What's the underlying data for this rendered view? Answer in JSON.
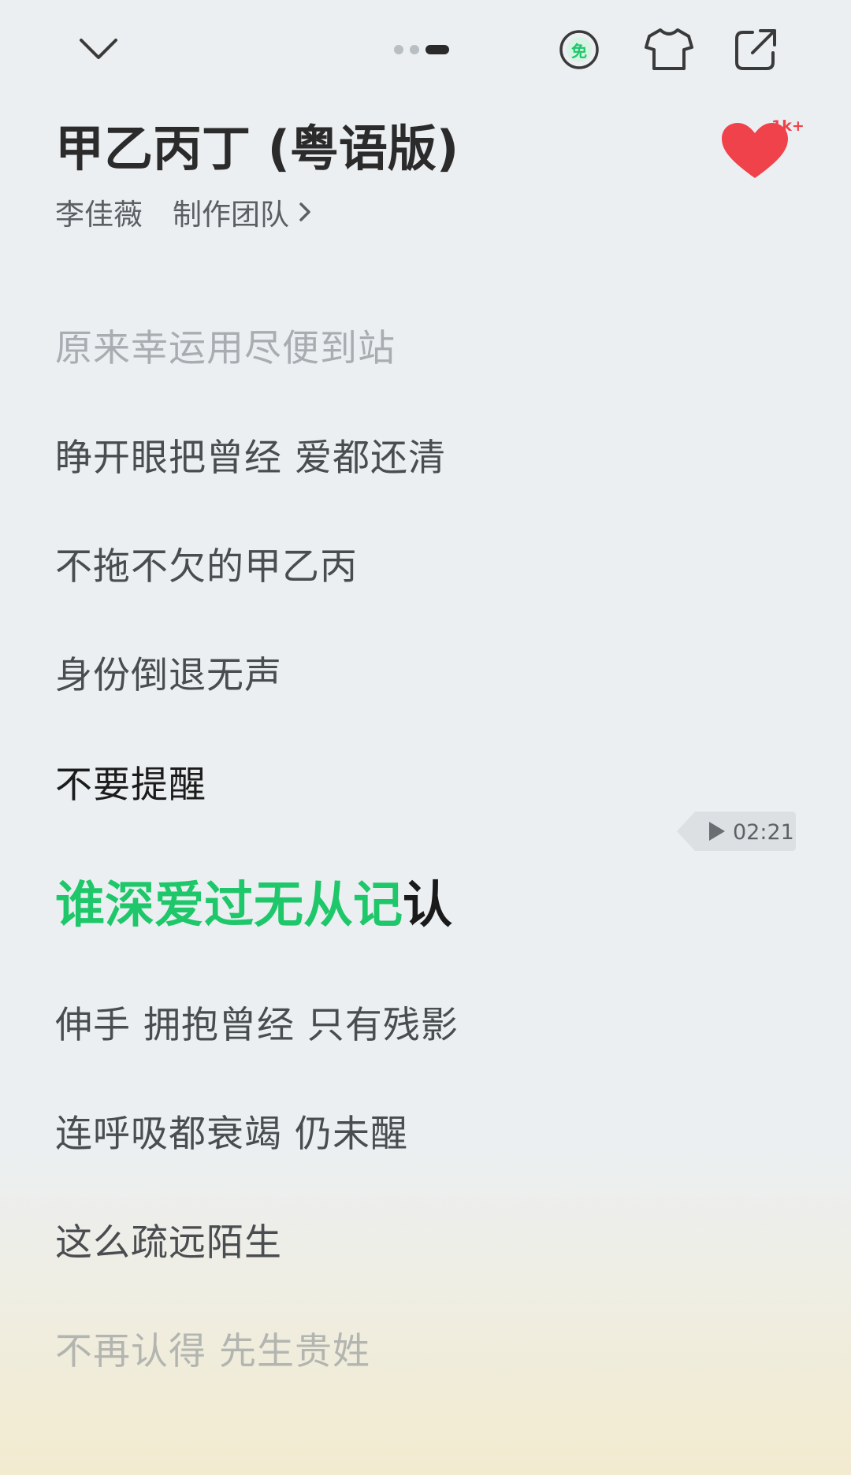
{
  "header": {
    "icons": {
      "collapse": "chevron-down-icon",
      "free": "free-badge-icon",
      "skin": "tshirt-icon",
      "share": "share-icon"
    },
    "free_badge_text": "免",
    "page_dots": 3,
    "active_page": 3
  },
  "song": {
    "title": "甲乙丙丁 (粤语版)",
    "artist": "李佳薇",
    "credits_label": "制作团队",
    "like_count": "1k+"
  },
  "lyrics": {
    "lines": [
      "原来幸运用尽便到站",
      "睁开眼把曾经 爱都还清",
      "不拖不欠的甲乙丙",
      "身份倒退无声",
      "不要提醒",
      "谁深爱过无从记认",
      "伸手 拥抱曾经 只有残影",
      "连呼吸都衰竭 仍未醒",
      "这么疏远陌生",
      "不再认得 先生贵姓"
    ],
    "current_index": 5,
    "current_sung": "谁深爱过无从记",
    "current_unsung": "认"
  },
  "seek": {
    "time": "02:21"
  },
  "colors": {
    "accent_green": "#1ec76a",
    "like_red": "#f0424b",
    "background": "#eceff1"
  }
}
